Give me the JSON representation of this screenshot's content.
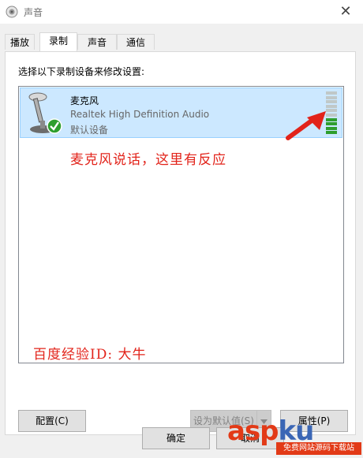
{
  "window": {
    "title": "声音",
    "app_icon": "speaker-icon",
    "close_glyph": "✕"
  },
  "tabs": [
    {
      "label": "播放",
      "active": false
    },
    {
      "label": "录制",
      "active": true
    },
    {
      "label": "声音",
      "active": false
    },
    {
      "label": "通信",
      "active": false
    }
  ],
  "instruction": "选择以下录制设备来修改设置:",
  "device": {
    "name": "麦克风",
    "driver": "Realtek High Definition Audio",
    "status": "默认设备",
    "icon": "microphone-icon",
    "badge_icon": "check-icon",
    "level_meter": {
      "bars_total": 10,
      "bars_active": 4
    }
  },
  "annotations": {
    "talk_hint": "麦克风说话，这里有反应",
    "credit": "百度经验ID: 大牛"
  },
  "buttons": {
    "configure": "配置(C)",
    "set_default": "设为默认值(S)",
    "properties": "属性(P)",
    "ok": "确定",
    "cancel": "取消"
  },
  "watermark": {
    "text_asp": "asp",
    "text_ku": "ku",
    "sub": "免费网站源码下载站"
  },
  "colors": {
    "selection_bg": "#cce8ff",
    "meter_on": "#2e9e2e",
    "meter_off": "#c0c8c8",
    "annotation": "#e2231a"
  }
}
